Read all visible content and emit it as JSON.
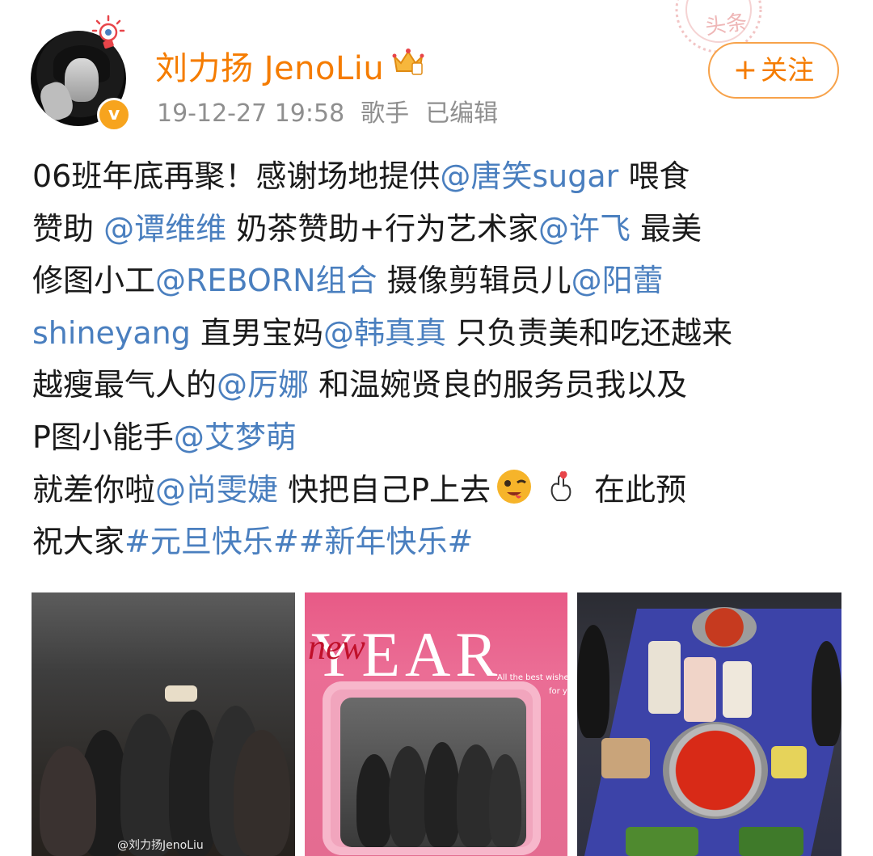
{
  "post": {
    "author": "刘力扬 JenoLiu",
    "timestamp": "19-12-27 19:58",
    "source": "歌手",
    "edited": "已编辑",
    "follow_label": "关注",
    "follow_plus": "+",
    "verify_mark": "v",
    "stamp_text": "头条",
    "lines": [
      [
        {
          "t": "06班年底再聚！感谢场地提供"
        },
        {
          "t": "@唐笑sugar",
          "m": 1
        },
        {
          "t": " 喂食"
        }
      ],
      [
        {
          "t": "赞助 "
        },
        {
          "t": "@谭维维",
          "m": 1
        },
        {
          "t": " 奶茶赞助+行为艺术家"
        },
        {
          "t": "@许飞",
          "m": 1
        },
        {
          "t": " 最美"
        }
      ],
      [
        {
          "t": "修图小工"
        },
        {
          "t": "@REBORN组合",
          "m": 1
        },
        {
          "t": " 摄像剪辑员儿"
        },
        {
          "t": "@阳蕾",
          "m": 1
        }
      ],
      [
        {
          "t": "shineyang",
          "m": 1
        },
        {
          "t": " 直男宝妈"
        },
        {
          "t": "@韩真真",
          "m": 1
        },
        {
          "t": " 只负责美和吃还越来"
        }
      ],
      [
        {
          "t": "越瘦最气人的"
        },
        {
          "t": "@厉娜",
          "m": 1
        },
        {
          "t": " 和温婉贤良的服务员我以及"
        }
      ],
      [
        {
          "t": "P图小能手"
        },
        {
          "t": "@艾梦萌",
          "m": 1
        }
      ],
      [
        {
          "t": "就差你啦"
        },
        {
          "t": "@尚雯婕",
          "m": 1
        },
        {
          "t": " 快把自己P上去"
        },
        {
          "e": "wink"
        },
        {
          "e": "finger-heart"
        },
        {
          "t": " 在此预"
        }
      ],
      [
        {
          "t": "祝大家"
        },
        {
          "t": "#元旦快乐##新年快乐#",
          "m": 1
        }
      ]
    ]
  },
  "images": {
    "watermark": "@刘力扬JenoLiu",
    "photo2_title_big": "YEAR",
    "photo2_title_script": "new",
    "photo2_wish_line1": "All the best wishes",
    "photo2_wish_line2": "for you"
  },
  "colors": {
    "name": "#f57c00",
    "link": "#4a7fbf",
    "meta": "#8f8f8f",
    "follow_border": "#f7a24a"
  }
}
